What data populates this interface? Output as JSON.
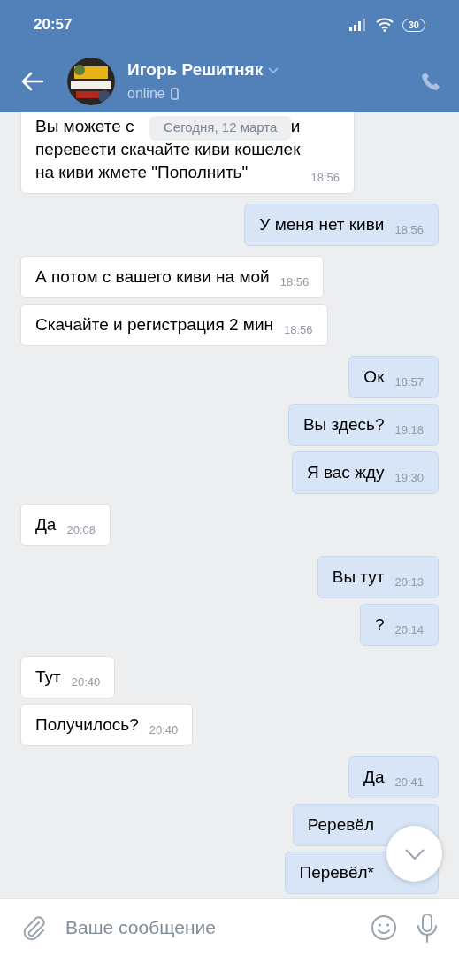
{
  "status_bar": {
    "time": "20:57",
    "battery": "30"
  },
  "header": {
    "name": "Игорь Решитняк",
    "status": "online"
  },
  "date_pill": "Сегодня, 12 марта",
  "messages": [
    {
      "kind": "incoming",
      "lines": [
        [
          "Вы можете с",
          "и"
        ],
        [
          "перевести  скачайте киви кошелек"
        ],
        [
          "на киви жмете \"Пополнить\""
        ]
      ],
      "time": "18:56"
    },
    {
      "kind": "outgoing",
      "lines": [
        [
          "У меня нет киви"
        ]
      ],
      "time": "18:56"
    },
    {
      "kind": "incoming",
      "lines": [
        [
          "А потом с вашего киви на мой"
        ]
      ],
      "time": "18:56"
    },
    {
      "kind": "incoming",
      "lines": [
        [
          "Скачайте и регистрация 2 мин"
        ]
      ],
      "time": "18:56"
    },
    {
      "kind": "outgoing",
      "lines": [
        [
          "Ок"
        ]
      ],
      "time": "18:57"
    },
    {
      "kind": "outgoing",
      "lines": [
        [
          "Вы здесь?"
        ]
      ],
      "time": "19:18"
    },
    {
      "kind": "outgoing",
      "lines": [
        [
          "Я вас жду"
        ]
      ],
      "time": "19:30"
    },
    {
      "kind": "incoming",
      "lines": [
        [
          "Да"
        ]
      ],
      "time": "20:08"
    },
    {
      "kind": "outgoing",
      "lines": [
        [
          "Вы тут"
        ]
      ],
      "time": "20:13"
    },
    {
      "kind": "outgoing",
      "lines": [
        [
          "?"
        ]
      ],
      "time": "20:14"
    },
    {
      "kind": "incoming",
      "lines": [
        [
          "Тут"
        ]
      ],
      "time": "20:40"
    },
    {
      "kind": "incoming",
      "lines": [
        [
          "Получилось?"
        ]
      ],
      "time": "20:40"
    },
    {
      "kind": "outgoing",
      "lines": [
        [
          "Да"
        ]
      ],
      "time": "20:41"
    },
    {
      "kind": "outgoing",
      "lines": [
        [
          "Реревёл"
        ]
      ]
    },
    {
      "kind": "outgoing",
      "lines": [
        [
          "Перевёл*"
        ]
      ]
    }
  ],
  "composer": {
    "placeholder": "Ваше сообщение"
  }
}
